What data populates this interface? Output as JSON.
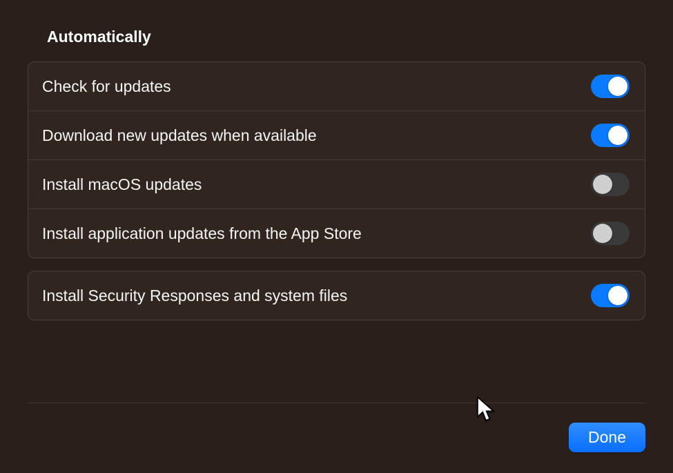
{
  "section_title": "Automatically",
  "group1": {
    "items": [
      {
        "label": "Check for updates",
        "enabled": true
      },
      {
        "label": "Download new updates when available",
        "enabled": true
      },
      {
        "label": "Install macOS updates",
        "enabled": false
      },
      {
        "label": "Install application updates from the App Store",
        "enabled": false
      }
    ]
  },
  "group2": {
    "items": [
      {
        "label": "Install Security Responses and system files",
        "enabled": true
      }
    ]
  },
  "footer": {
    "done_label": "Done"
  }
}
